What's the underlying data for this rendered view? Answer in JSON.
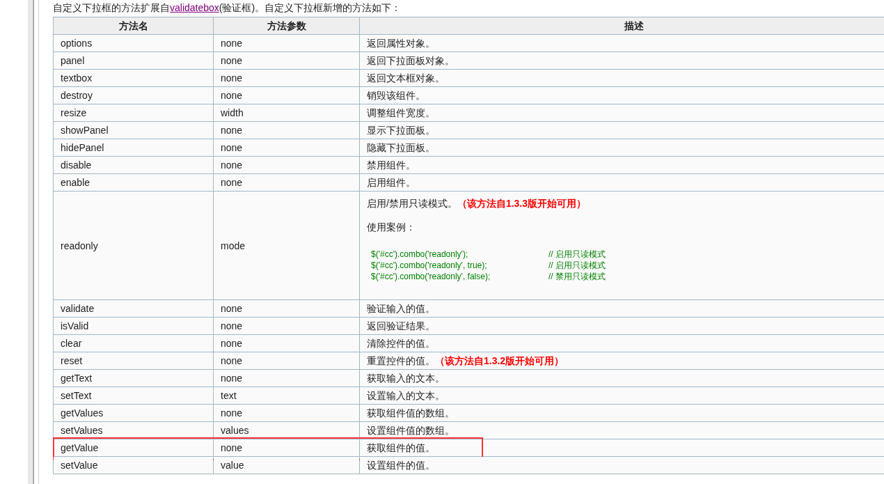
{
  "intro": {
    "before": "自定义下拉框的方法扩展自",
    "link": "validatebox",
    "after": "(验证框)。自定义下拉框新增的方法如下："
  },
  "table": {
    "columns": [
      "方法名",
      "方法参数",
      "描述"
    ],
    "rows": [
      {
        "name": "options",
        "param": "none",
        "desc": "返回属性对象。",
        "highlighted": false
      },
      {
        "name": "panel",
        "param": "none",
        "desc": "返回下拉面板对象。",
        "highlighted": false
      },
      {
        "name": "textbox",
        "param": "none",
        "desc": "返回文本框对象。",
        "highlighted": false
      },
      {
        "name": "destroy",
        "param": "none",
        "desc": "销毁该组件。",
        "highlighted": false
      },
      {
        "name": "resize",
        "param": "width",
        "desc": "调整组件宽度。",
        "highlighted": false
      },
      {
        "name": "showPanel",
        "param": "none",
        "desc": "显示下拉面板。",
        "highlighted": false
      },
      {
        "name": "hidePanel",
        "param": "none",
        "desc": "隐藏下拉面板。",
        "highlighted": false
      },
      {
        "name": "disable",
        "param": "none",
        "desc": "禁用组件。",
        "highlighted": false
      },
      {
        "name": "enable",
        "param": "none",
        "desc": "启用组件。",
        "highlighted": false
      },
      {
        "name": "readonly",
        "param": "mode",
        "desc": "启用/禁用只读模式。",
        "note": "（该方法自1.3.3版开始可用）",
        "example_label": "使用案例：",
        "code": [
          {
            "code": "$('#cc').combo('readonly');",
            "comment": "// 启用只读模式"
          },
          {
            "code": "$('#cc').combo('readonly', true);",
            "comment": "// 启用只读模式"
          },
          {
            "code": "$('#cc').combo('readonly', false);",
            "comment": "// 禁用只读模式"
          }
        ],
        "highlighted": false
      },
      {
        "name": "validate",
        "param": "none",
        "desc": "验证输入的值。",
        "highlighted": false
      },
      {
        "name": "isValid",
        "param": "none",
        "desc": "返回验证结果。",
        "highlighted": false
      },
      {
        "name": "clear",
        "param": "none",
        "desc": "清除控件的值。",
        "highlighted": false
      },
      {
        "name": "reset",
        "param": "none",
        "desc": "重置控件的值。",
        "note": "（该方法自1.3.2版开始可用）",
        "highlighted": false
      },
      {
        "name": "getText",
        "param": "none",
        "desc": "获取输入的文本。",
        "highlighted": false
      },
      {
        "name": "setText",
        "param": "text",
        "desc": "设置输入的文本。",
        "highlighted": false
      },
      {
        "name": "getValues",
        "param": "none",
        "desc": "获取组件值的数组。",
        "highlighted": false
      },
      {
        "name": "setValues",
        "param": "values",
        "desc": "设置组件值的数组。",
        "highlighted": false
      },
      {
        "name": "getValue",
        "param": "none",
        "desc": "获取组件的值。",
        "highlighted": true
      },
      {
        "name": "setValue",
        "param": "value",
        "desc": "设置组件的值。",
        "highlighted": false
      }
    ]
  }
}
